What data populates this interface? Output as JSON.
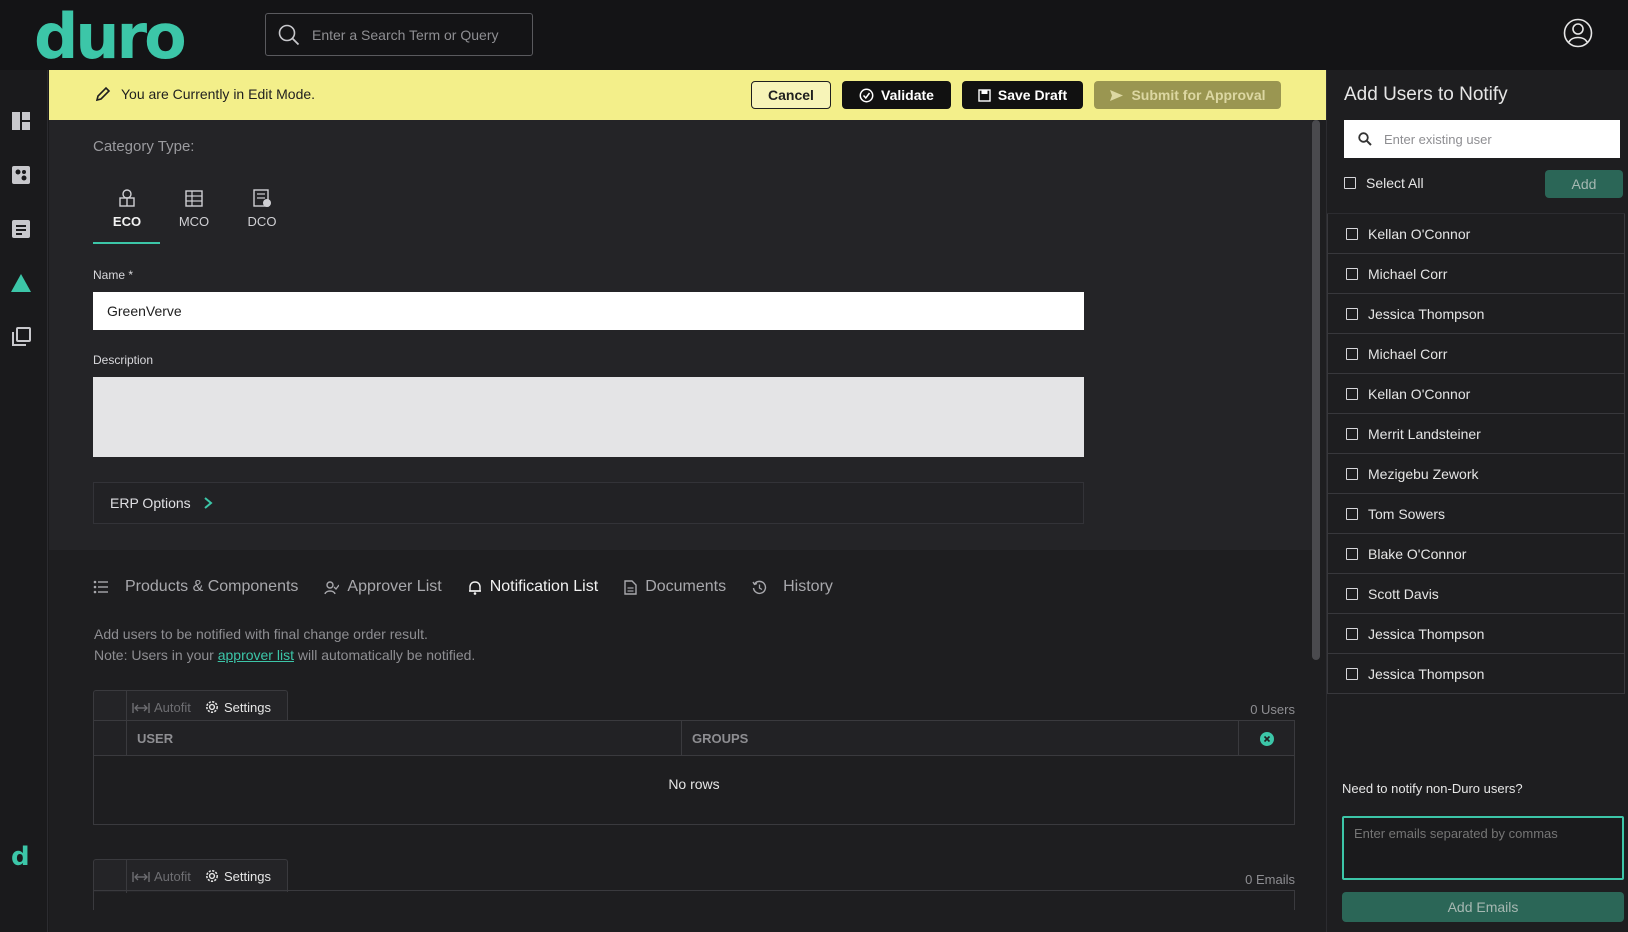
{
  "header": {
    "logo_text": "duro",
    "search_placeholder": "Enter a Search Term or Query"
  },
  "editbar": {
    "message": "You are Currently in Edit Mode.",
    "cancel_label": "Cancel",
    "validate_label": "Validate",
    "save_draft_label": "Save Draft",
    "submit_label": "Submit for Approval"
  },
  "form": {
    "category_label": "Category Type:",
    "category_tabs": [
      {
        "label": "ECO",
        "active": true
      },
      {
        "label": "MCO",
        "active": false
      },
      {
        "label": "DCO",
        "active": false
      }
    ],
    "name_label": "Name *",
    "name_value": "GreenVerve",
    "description_label": "Description",
    "description_value": "",
    "erp_label": "ERP Options"
  },
  "lower_tabs": [
    {
      "label": "Products & Components",
      "icon": "list-icon"
    },
    {
      "label": "Approver List",
      "icon": "approver-icon"
    },
    {
      "label": "Notification List",
      "icon": "bell-icon",
      "active": true
    },
    {
      "label": "Documents",
      "icon": "document-icon"
    },
    {
      "label": "History",
      "icon": "history-icon"
    }
  ],
  "notification": {
    "line1": "Add users to be notified with final change order result.",
    "line2_prefix": "Note: Users in your ",
    "line2_link": "approver list",
    "line2_suffix": " will automatically be notified."
  },
  "grid_users": {
    "autofit_label": "Autofit",
    "settings_label": "Settings",
    "count_label": "0 Users",
    "columns": [
      "USER",
      "GROUPS"
    ],
    "empty_text": "No rows"
  },
  "grid_emails": {
    "autofit_label": "Autofit",
    "settings_label": "Settings",
    "count_label": "0 Emails"
  },
  "right_panel": {
    "title": "Add Users to Notify",
    "search_placeholder": "Enter existing user",
    "select_all_label": "Select All",
    "add_label": "Add",
    "users": [
      "Kellan O'Connor",
      "Michael Corr",
      "Jessica Thompson",
      "Michael Corr",
      "Kellan O'Connor",
      "Merrit Landsteiner",
      "Mezigebu Zework",
      "Tom Sowers",
      "Blake O'Connor",
      "Scott Davis",
      "Jessica Thompson",
      "Jessica Thompson"
    ],
    "non_duro_label": "Need to notify non-Duro users?",
    "emails_placeholder": "Enter emails separated by commas",
    "add_emails_label": "Add Emails"
  },
  "colors": {
    "accent": "#3cc6a8",
    "edit_banner": "#f3ef8a",
    "background": "#1e1e20"
  }
}
